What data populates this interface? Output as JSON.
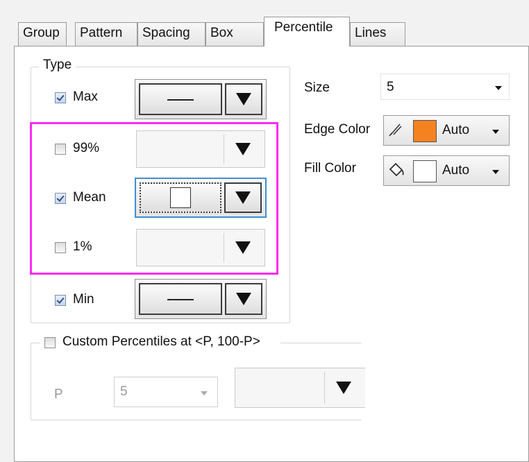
{
  "tabs": [
    {
      "label": "Group",
      "active": false
    },
    {
      "label": "Pattern",
      "active": false
    },
    {
      "label": "Spacing",
      "active": false
    },
    {
      "label": "Box",
      "active": false
    },
    {
      "label": "Percentile",
      "active": true
    },
    {
      "label": "Lines",
      "active": false
    }
  ],
  "type_group": {
    "legend": "Type",
    "rows": [
      {
        "label": "Max",
        "checked": true,
        "symbol": "line",
        "enabled": true
      },
      {
        "label": "99%",
        "checked": false,
        "symbol": "none",
        "enabled": false
      },
      {
        "label": "Mean",
        "checked": true,
        "symbol": "square",
        "enabled": true,
        "focused": true
      },
      {
        "label": "1%",
        "checked": false,
        "symbol": "none",
        "enabled": false
      },
      {
        "label": "Min",
        "checked": true,
        "symbol": "line",
        "enabled": true
      }
    ]
  },
  "size": {
    "label": "Size",
    "value": "5"
  },
  "edge_color": {
    "label": "Edge Color",
    "value": "Auto",
    "swatch": "#f58220",
    "icon": "pen-icon"
  },
  "fill_color": {
    "label": "Fill Color",
    "value": "Auto",
    "swatch": "#ffffff",
    "icon": "paint-bucket-icon"
  },
  "custom": {
    "label": "Custom Percentiles at <P, 100-P>",
    "checked": false,
    "p_label": "P",
    "p_value": "5"
  },
  "colors": {
    "highlight": "#ff2bf1",
    "focus": "#3f8fd0"
  }
}
